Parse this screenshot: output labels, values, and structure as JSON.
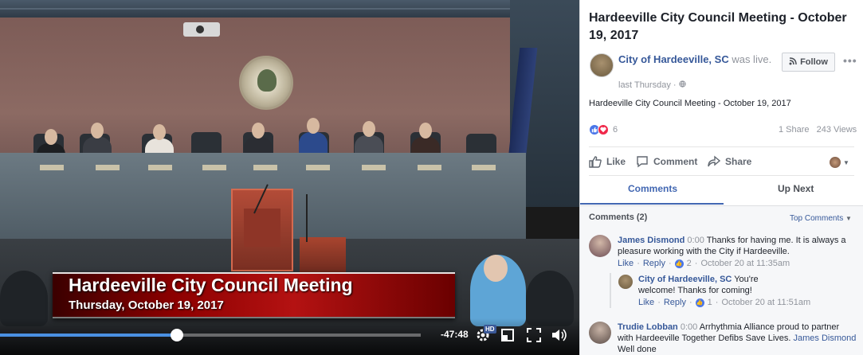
{
  "video": {
    "lower_third_title": "Hardeeville City Council Meeting",
    "lower_third_subtitle": "Thursday, October 19, 2017",
    "time_remaining": "-47:48",
    "progress_fraction": 0.42,
    "hd_badge": "HD",
    "icons": [
      "settings-icon",
      "fullscreen-exit-icon",
      "expand-icon",
      "volume-icon"
    ]
  },
  "post": {
    "title": "Hardeeville City Council Meeting - October 19, 2017",
    "page_name": "City of Hardeeville, SC",
    "page_suffix": " was live.",
    "meta": "last Thursday · ",
    "follow_label": "Follow",
    "more_label": "•••",
    "text": "Hardeeville City Council Meeting - October 19, 2017",
    "reaction_count": "6",
    "shares": "1 Share",
    "views": "243 Views"
  },
  "actions": {
    "like": "Like",
    "comment": "Comment",
    "share": "Share"
  },
  "tabs": {
    "comments": "Comments",
    "up_next": "Up Next"
  },
  "comments": {
    "header": "Comments (2)",
    "sort": "Top Comments",
    "items": [
      {
        "author": "James Dismond",
        "time": " 0:00 ",
        "text": "Thanks for having me. It is always a pleasure working with the City if Hardeeville.",
        "like": "Like",
        "reply": "Reply",
        "likes": "2",
        "date": "October 20 at 11:35am",
        "reply_item": {
          "author": "City of Hardeeville, SC",
          "text": " You're welcome! Thanks for coming!",
          "like": "Like",
          "reply": "Reply",
          "likes": "1",
          "date": "October 20 at 11:51am"
        }
      },
      {
        "author": "Trudie Lobban",
        "time": " 0:00 ",
        "text": "Arrhythmia Alliance proud to partner with Hardeeville Together Defibs Save Lives. ",
        "tag": "James Dismond",
        "tail": " Well done"
      }
    ]
  },
  "colors": {
    "link": "#365899",
    "accent": "#4267b2",
    "lower_third": "#b41212",
    "progress": "#4a90e2"
  }
}
